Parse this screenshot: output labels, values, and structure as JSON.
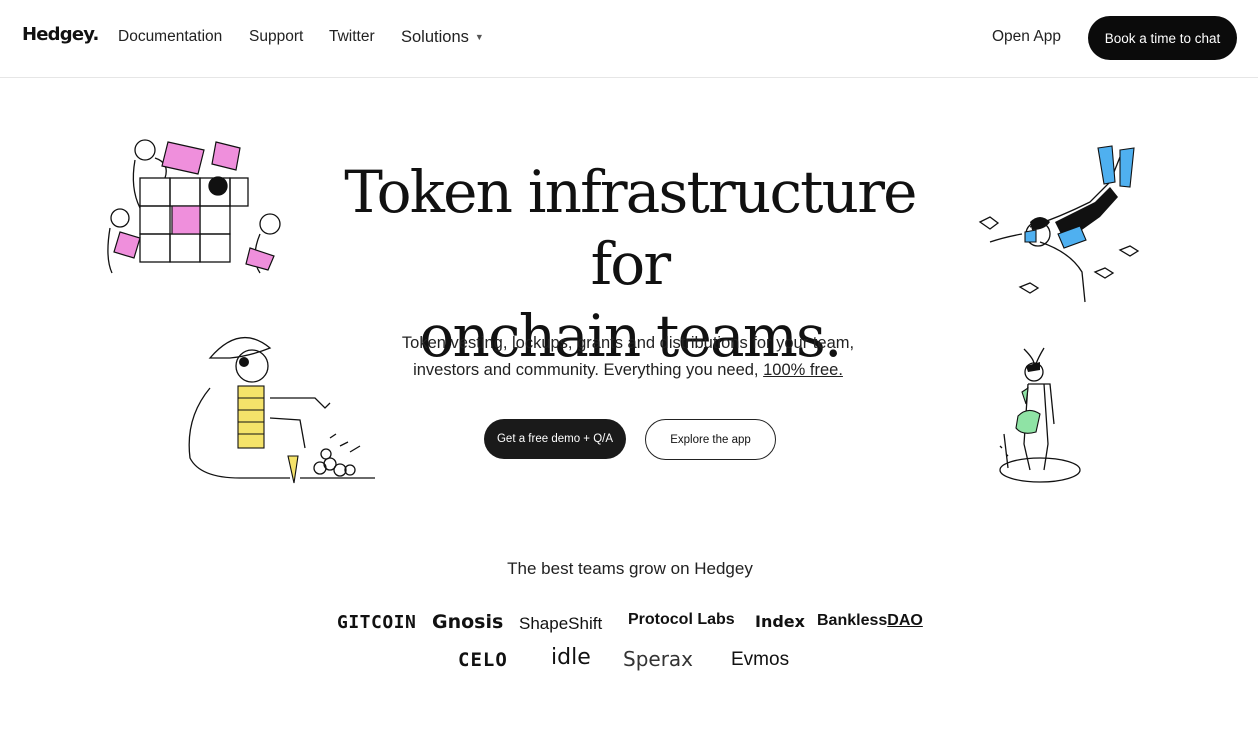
{
  "nav": {
    "logo": "Hedgey.",
    "links": [
      "Documentation",
      "Support",
      "Twitter"
    ],
    "solutions": "Solutions",
    "open_app": "Open App",
    "cta": "Book a time to chat"
  },
  "hero": {
    "title_line1": "Token infrastructure for",
    "title_line2": "onchain teams.",
    "sub_line1": "Token vesting, lockups, grants and distributions for your team,",
    "sub_line2": "investors and community. Everything you need,",
    "sub_link": "100% free.",
    "primary_button": "Get a free demo + Q/A",
    "secondary_button": "Explore the app"
  },
  "partners": {
    "heading": "The best teams grow on Hedgey",
    "row1": [
      "GITCOIN",
      "Gnosis",
      "ShapeShift",
      "Protocol Labs",
      "Index",
      "Bankless",
      "DAO"
    ],
    "row2": [
      "CELO",
      "idle",
      "Sperax",
      "Evmos"
    ]
  },
  "colors": {
    "accent_pink": "#ef8fdc",
    "accent_blue": "#4fb0f0",
    "accent_yellow": "#f5e36a",
    "accent_green": "#8fe3a5",
    "button_dark": "#0b0b0b"
  }
}
